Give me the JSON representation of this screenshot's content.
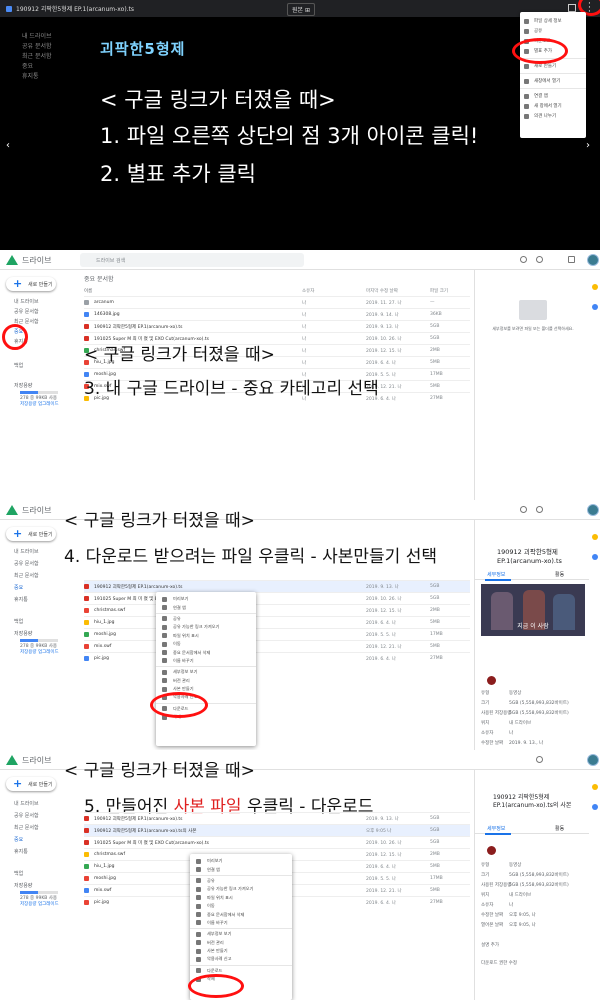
{
  "panel1": {
    "video_title": "190912 괴팍한5형제 EP.1(arcanum-xo).ts",
    "resolution_label": "원본 ⊞",
    "logo_main": "괴팍한",
    "logo_accent": "5형제",
    "menu_items": [
      "파일 상세 정보",
      "공유",
      "다운로드",
      "별표 추가",
      "새로 만들기",
      "새창에서 열기",
      "연결 앱",
      "새 창에서 열기",
      "의견 나누기",
      "도움말 및 피드백"
    ],
    "lines": [
      "< 구글 링크가 터졌을 때>",
      "1. 파일 오른쪽 상단의 점 3개 아이콘 클릭!",
      "2. 별표 추가 클릭"
    ]
  },
  "drive": {
    "name": "드라이브",
    "search_placeholder": "드라이브 검색",
    "new_button": "새로 만들기",
    "nav": [
      "내 드라이브",
      "공유 문서함",
      "최근 문서함",
      "중요",
      "휴지통"
    ],
    "backup_label": "백업",
    "storage_label": "저장용량",
    "storage_used": "278 중 99KB 사용",
    "storage_upgrade": "저장용량 업그레이드",
    "col_name": "이름",
    "col_owner": "소유자",
    "col_modified": "마지막 수정 날짜",
    "col_size": "파일 크기"
  },
  "panel2": {
    "crumb": "중요 문서함",
    "files": [
      {
        "name": "arcanum",
        "owner": "나",
        "date": "2019. 11. 27. 나",
        "size": "—"
      },
      {
        "name": "146308.jpg",
        "owner": "나",
        "date": "2019. 9. 14. 나",
        "size": "36KB"
      },
      {
        "name": "190912 괴팍한5형제 EP.1(arcanum-xo).ts",
        "owner": "나",
        "date": "2019. 9. 13. 나",
        "size": "5GB"
      },
      {
        "name": "191025 Super M 최 미 쳤 및 EXO Cut(arcanum-xo).ts",
        "owner": "나",
        "date": "2019. 10. 26. 나",
        "size": "5GB"
      },
      {
        "name": "christmas.swf",
        "owner": "나",
        "date": "2019. 12. 15. 나",
        "size": "2MB"
      },
      {
        "name": "hiu_1.jpg",
        "owner": "나",
        "date": "2019. 6. 4. 나",
        "size": "5MB"
      },
      {
        "name": "moshi.jpg",
        "owner": "나",
        "date": "2019. 5. 5. 나",
        "size": "17MB"
      },
      {
        "name": "mix.swf",
        "owner": "나",
        "date": "2019. 12. 21. 나",
        "size": "5MB"
      },
      {
        "name": "pic.jpg",
        "owner": "나",
        "date": "2019. 6. 4. 나",
        "size": "27MB"
      }
    ],
    "details_empty": "세부정보를 보려면 파일 또는 폴더를 선택하세요.",
    "overlay": [
      "< 구글 링크가 터졌을 때>",
      "3. 내 구글 드라이브 - 중요 카테고리 선택"
    ]
  },
  "panel3": {
    "overlay": [
      "< 구글 링크가 터졌을 때>",
      "4. 다운로드 받으려는 파일 우클릭 - 사본만들기 선택"
    ],
    "files": [
      {
        "name": "190912 괴팍한5형제 EP.1(arcanum-xo).ts",
        "date": "2019. 9. 13. 나",
        "size": "5GB"
      },
      {
        "name": "191025 Super M 최 미 쳤 및 EXO Cut(arcanum-xo).ts",
        "date": "2019. 10. 26. 나",
        "size": "5GB"
      },
      {
        "name": "christmas.swf",
        "date": "2019. 12. 15. 나",
        "size": "2MB"
      },
      {
        "name": "hiu_1.jpg",
        "date": "2019. 6. 4. 나",
        "size": "5MB"
      },
      {
        "name": "moshi.jpg",
        "date": "2019. 5. 5. 나",
        "size": "17MB"
      },
      {
        "name": "mix.swf",
        "date": "2019. 12. 21. 나",
        "size": "5MB"
      },
      {
        "name": "pic.jpg",
        "date": "2019. 6. 4. 나",
        "size": "27MB"
      }
    ],
    "menu": [
      "미리보기",
      "연결 앱",
      "공유",
      "공유 가능한 링크 가져오기",
      "파일 위치 표시",
      "이동",
      "중요 문서함에서 삭제",
      "이름 바꾸기",
      "세부정보 보기",
      "버전 관리",
      "사본 만들기",
      "악용사례 신고",
      "다운로드",
      "삭제"
    ],
    "detail_title": "190912 괴팍한5형제 EP.1(arcanum-xo).ts",
    "detail_tabs": [
      "세부정보",
      "활동"
    ],
    "thumb_caption": "지금 이 사람",
    "detail_rows": [
      [
        "유형",
        "동영상"
      ],
      [
        "크기",
        "5GB (5,558,993,832바이트)"
      ],
      [
        "사용된 저장용량",
        "5GB (5,558,993,832바이트)"
      ],
      [
        "위치",
        "내 드라이브"
      ],
      [
        "소유자",
        "나"
      ],
      [
        "수정한 날짜",
        "2019. 9. 13., 나"
      ],
      [
        "열어본 날짜",
        "2019. 9. 13., 나"
      ]
    ]
  },
  "panel4": {
    "overlay_start": "5. 만들어진 ",
    "overlay_red": "사본 파일",
    "overlay_end": " 우클릭 - 다운로드",
    "overlay_title": "< 구글 링크가 터졌을 때>",
    "files": [
      {
        "name": "190912 괴팍한5형제 EP.1(arcanum-xo).ts",
        "date": "2019. 9. 13. 나",
        "size": "5GB"
      },
      {
        "name": "190912 괴팍한5형제 EP.1(arcanum-xo).ts의 사본",
        "date": "오후 9:05 나",
        "size": "5GB"
      },
      {
        "name": "191025 Super M 최 미 쳤 및 EXO Cut(arcanum-xo).ts",
        "date": "2019. 10. 26. 나",
        "size": "5GB"
      },
      {
        "name": "christmas.swf",
        "date": "2019. 12. 15. 나",
        "size": "2MB"
      },
      {
        "name": "hiu_1.jpg",
        "date": "2019. 6. 4. 나",
        "size": "5MB"
      },
      {
        "name": "moshi.jpg",
        "date": "2019. 5. 5. 나",
        "size": "17MB"
      },
      {
        "name": "mix.swf",
        "date": "2019. 12. 21. 나",
        "size": "5MB"
      },
      {
        "name": "pic.jpg",
        "date": "2019. 6. 4. 나",
        "size": "27MB"
      }
    ],
    "menu": [
      "미리보기",
      "연결 앱",
      "공유",
      "공유 가능한 링크 가져오기",
      "파일 위치 표시",
      "이동",
      "중요 문서함에서 삭제",
      "이름 바꾸기",
      "세부정보 보기",
      "버전 관리",
      "사본 만들기",
      "악용사례 신고",
      "다운로드",
      "삭제"
    ],
    "detail_title": "190912 괴팍한5형제 EP.1(arcanum-xo).ts의 사본",
    "detail_rows": [
      [
        "유형",
        "동영상"
      ],
      [
        "크기",
        "5GB (5,558,993,832바이트)"
      ],
      [
        "사용된 저장용량",
        "5GB (5,558,993,832바이트)"
      ],
      [
        "위치",
        "내 드라이브"
      ],
      [
        "소유자",
        "나"
      ],
      [
        "수정한 날짜",
        "오후 9:05, 나"
      ],
      [
        "열어본 날짜",
        "오후 9:05, 나"
      ]
    ],
    "detail_extra": [
      "설명 추가",
      "다운로드 권한 수정"
    ]
  }
}
